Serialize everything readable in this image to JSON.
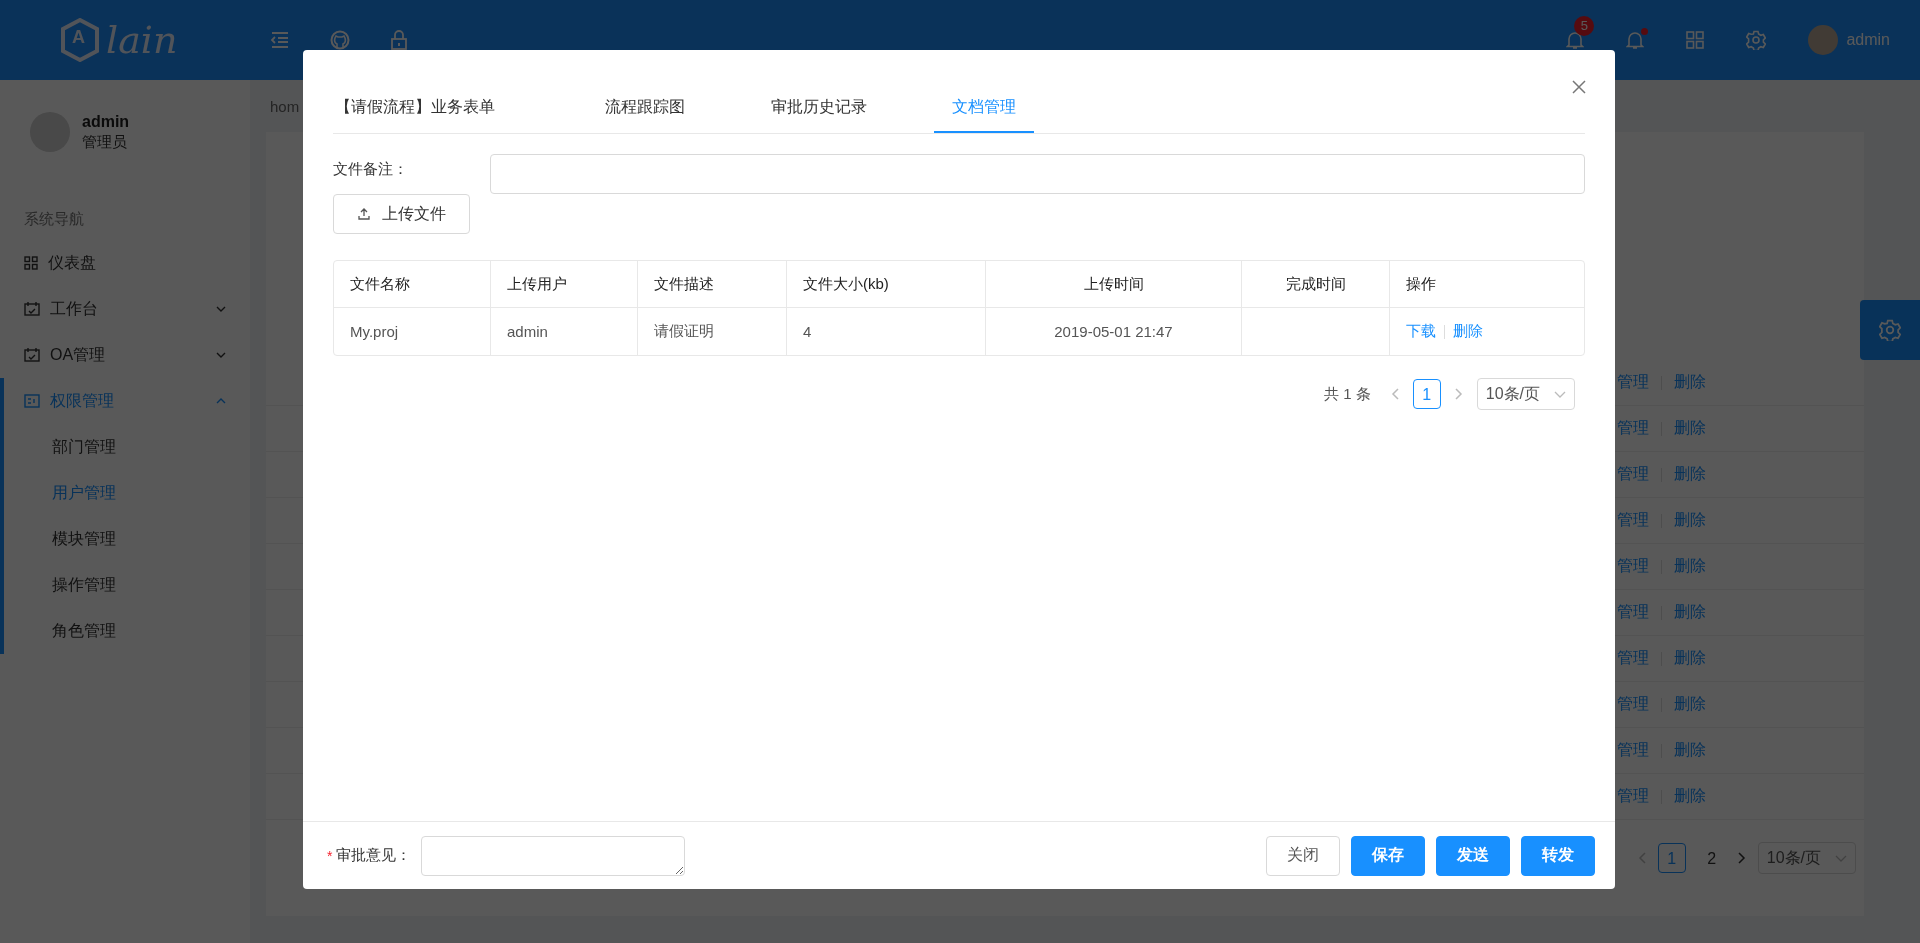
{
  "header": {
    "logo_mark": "A",
    "logo_text": "lain",
    "notice_badge": "5",
    "messages_dot": true,
    "user_name": "admin"
  },
  "sidebar": {
    "user": {
      "name": "admin",
      "role": "管理员"
    },
    "nav_title": "系统导航",
    "items": [
      {
        "label": "仪表盘",
        "selected": false
      },
      {
        "label": "工作台",
        "selected": false,
        "expanded": false
      },
      {
        "label": "OA管理",
        "selected": false,
        "expanded": false
      },
      {
        "label": "权限管理",
        "selected": true,
        "expanded": true,
        "children": [
          {
            "label": "部门管理",
            "selected": false
          },
          {
            "label": "用户管理",
            "selected": true
          },
          {
            "label": "模块管理",
            "selected": false
          },
          {
            "label": "操作管理",
            "selected": false
          },
          {
            "label": "角色管理",
            "selected": false
          }
        ]
      }
    ]
  },
  "breadcrumb": "hom",
  "background_table": {
    "rows": [
      {
        "actions": [
          "管理",
          "删除"
        ]
      },
      {
        "actions": [
          "管理",
          "删除"
        ]
      },
      {
        "actions": [
          "管理",
          "删除"
        ]
      },
      {
        "actions": [
          "管理",
          "删除"
        ]
      },
      {
        "actions": [
          "管理",
          "删除"
        ]
      },
      {
        "actions": [
          "管理",
          "删除"
        ]
      },
      {
        "actions": [
          "管理",
          "删除"
        ]
      },
      {
        "actions": [
          "管理",
          "删除"
        ]
      },
      {
        "actions": [
          "管理",
          "删除"
        ]
      },
      {
        "actions": [
          "管理",
          "删除"
        ]
      }
    ],
    "pagination": {
      "pages": [
        {
          "label": "1",
          "selected": true
        },
        {
          "label": "2",
          "selected": false
        }
      ],
      "page_size": "10条/页"
    }
  },
  "modal": {
    "tabs": [
      {
        "label": "【请假流程】业务表单",
        "selected": false
      },
      {
        "label": "流程跟踪图",
        "selected": false
      },
      {
        "label": "审批历史记录",
        "selected": false
      },
      {
        "label": "文档管理",
        "selected": true
      }
    ],
    "note_label": "文件备注：",
    "upload_button": "上传文件",
    "table": {
      "columns": [
        {
          "label": "文件名称",
          "centered": false
        },
        {
          "label": "上传用户",
          "centered": false
        },
        {
          "label": "文件描述",
          "centered": false
        },
        {
          "label": "文件大小(kb)",
          "centered": false
        },
        {
          "label": "上传时间",
          "centered": true
        },
        {
          "label": "完成时间",
          "centered": true
        },
        {
          "label": "操作",
          "centered": false
        }
      ],
      "rows": [
        {
          "cells": [
            "My.proj",
            "admin",
            "请假证明",
            "4",
            "2019-05-01 21:47"
          ],
          "actions": [
            "下载",
            "删除"
          ]
        }
      ]
    },
    "pagination": {
      "total": "共 1 条",
      "pages": [
        {
          "label": "1",
          "selected": true
        }
      ],
      "page_size": "10条/页"
    },
    "footer": {
      "opinion_label": "审批意见：",
      "required_mark": "*",
      "buttons": [
        {
          "label": "关闭",
          "kind": "default"
        },
        {
          "label": "保存",
          "kind": "primary"
        },
        {
          "label": "发送",
          "kind": "primary"
        },
        {
          "label": "转发",
          "kind": "primary"
        }
      ]
    }
  }
}
